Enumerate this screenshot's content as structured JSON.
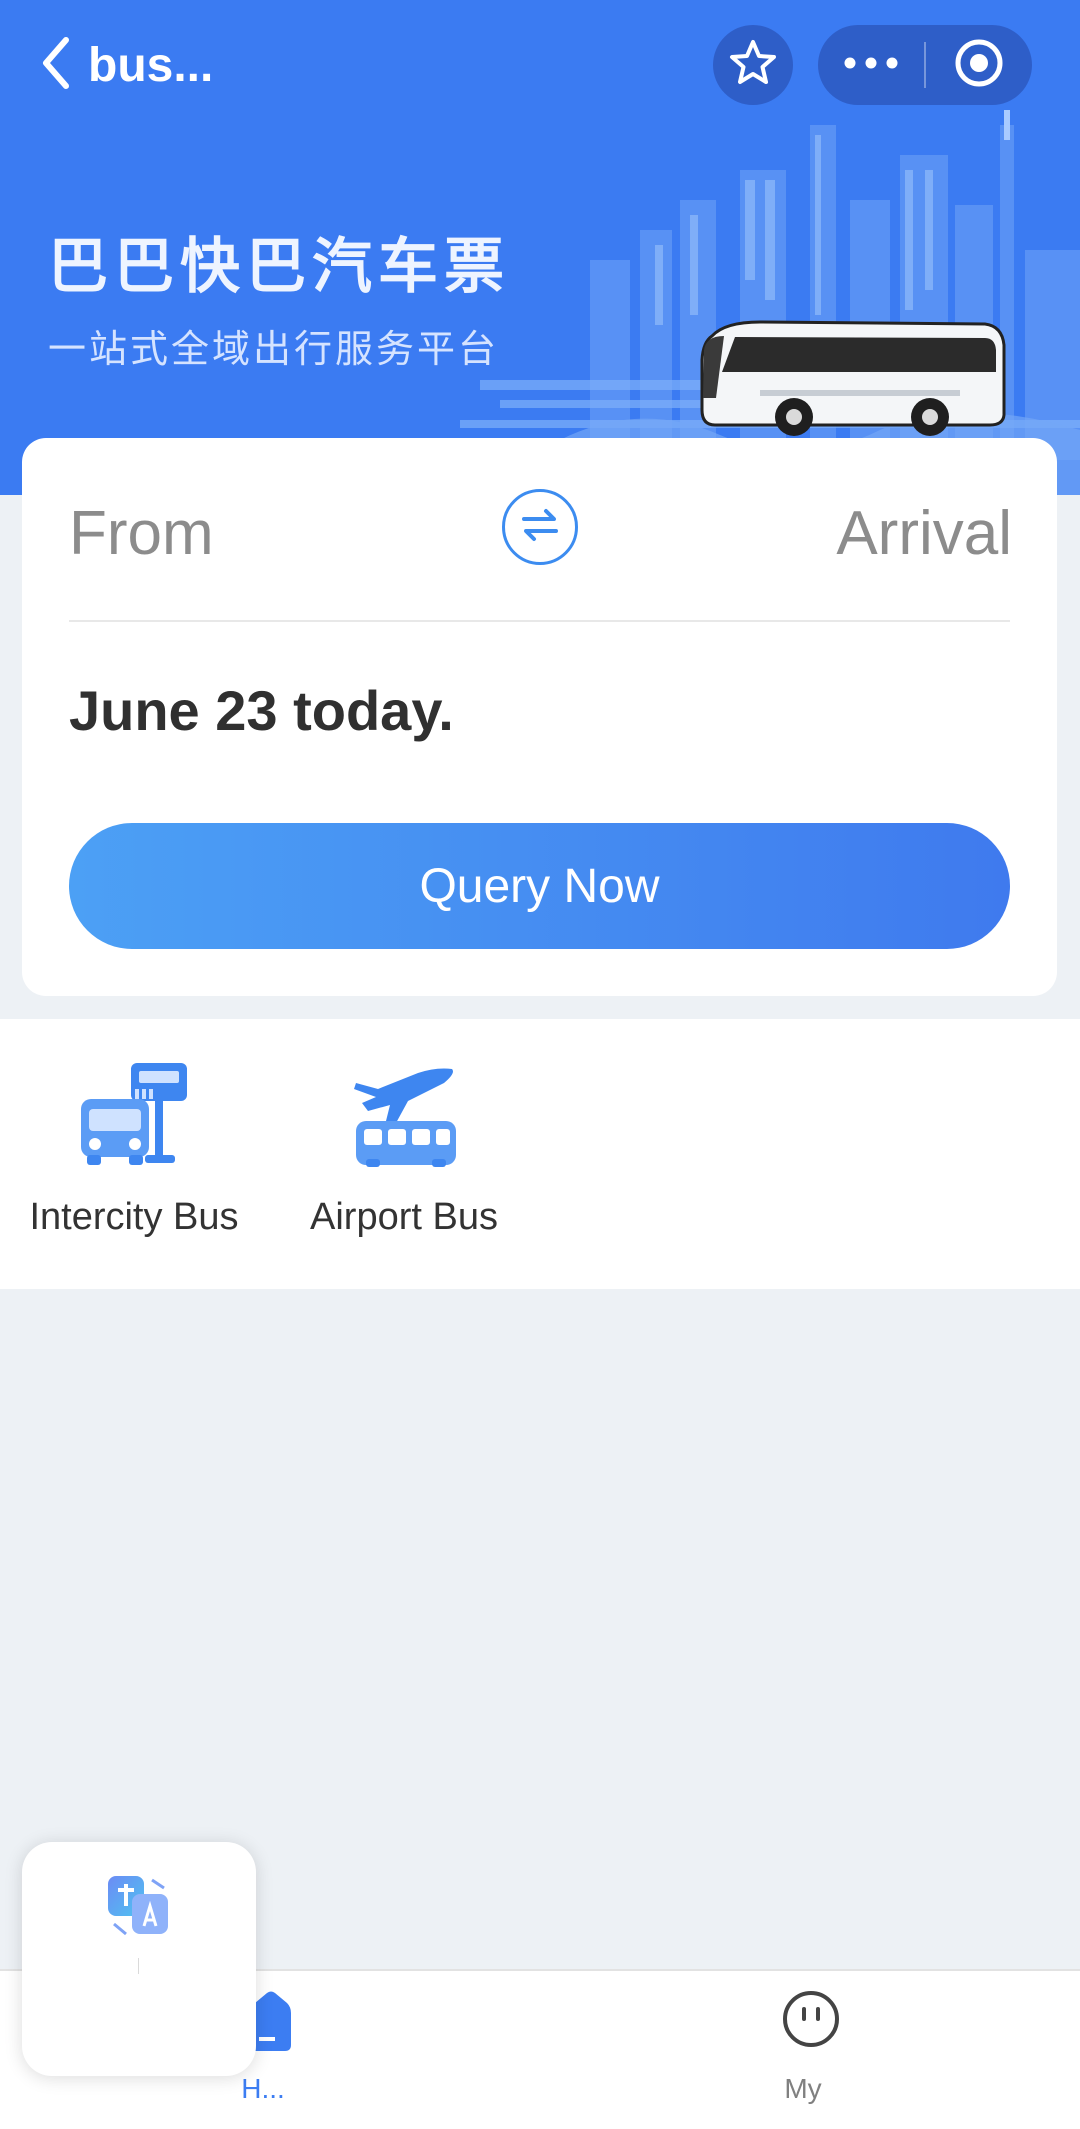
{
  "header": {
    "back_label": "bus...",
    "title_cn": "巴巴快巴汽车票",
    "subtitle_cn": "一站式全域出行服务平台",
    "icons": [
      "back-chevron-icon",
      "star-icon",
      "more-icon",
      "record-icon"
    ]
  },
  "search": {
    "from_label": "From",
    "arrival_label": "Arrival",
    "date_text": "June 23 today.",
    "query_button": "Query Now"
  },
  "categories": [
    {
      "label": "Intercity Bus",
      "icon": "intercity-bus-icon"
    },
    {
      "label": "Airport Bus",
      "icon": "airport-bus-icon"
    }
  ],
  "tabbar": {
    "home_label": "H...",
    "my_label": "My"
  },
  "colors": {
    "brand_blue": "#3B7BF2",
    "accent_blue": "#3C8CF0",
    "page_bg": "#EDF1F5"
  }
}
